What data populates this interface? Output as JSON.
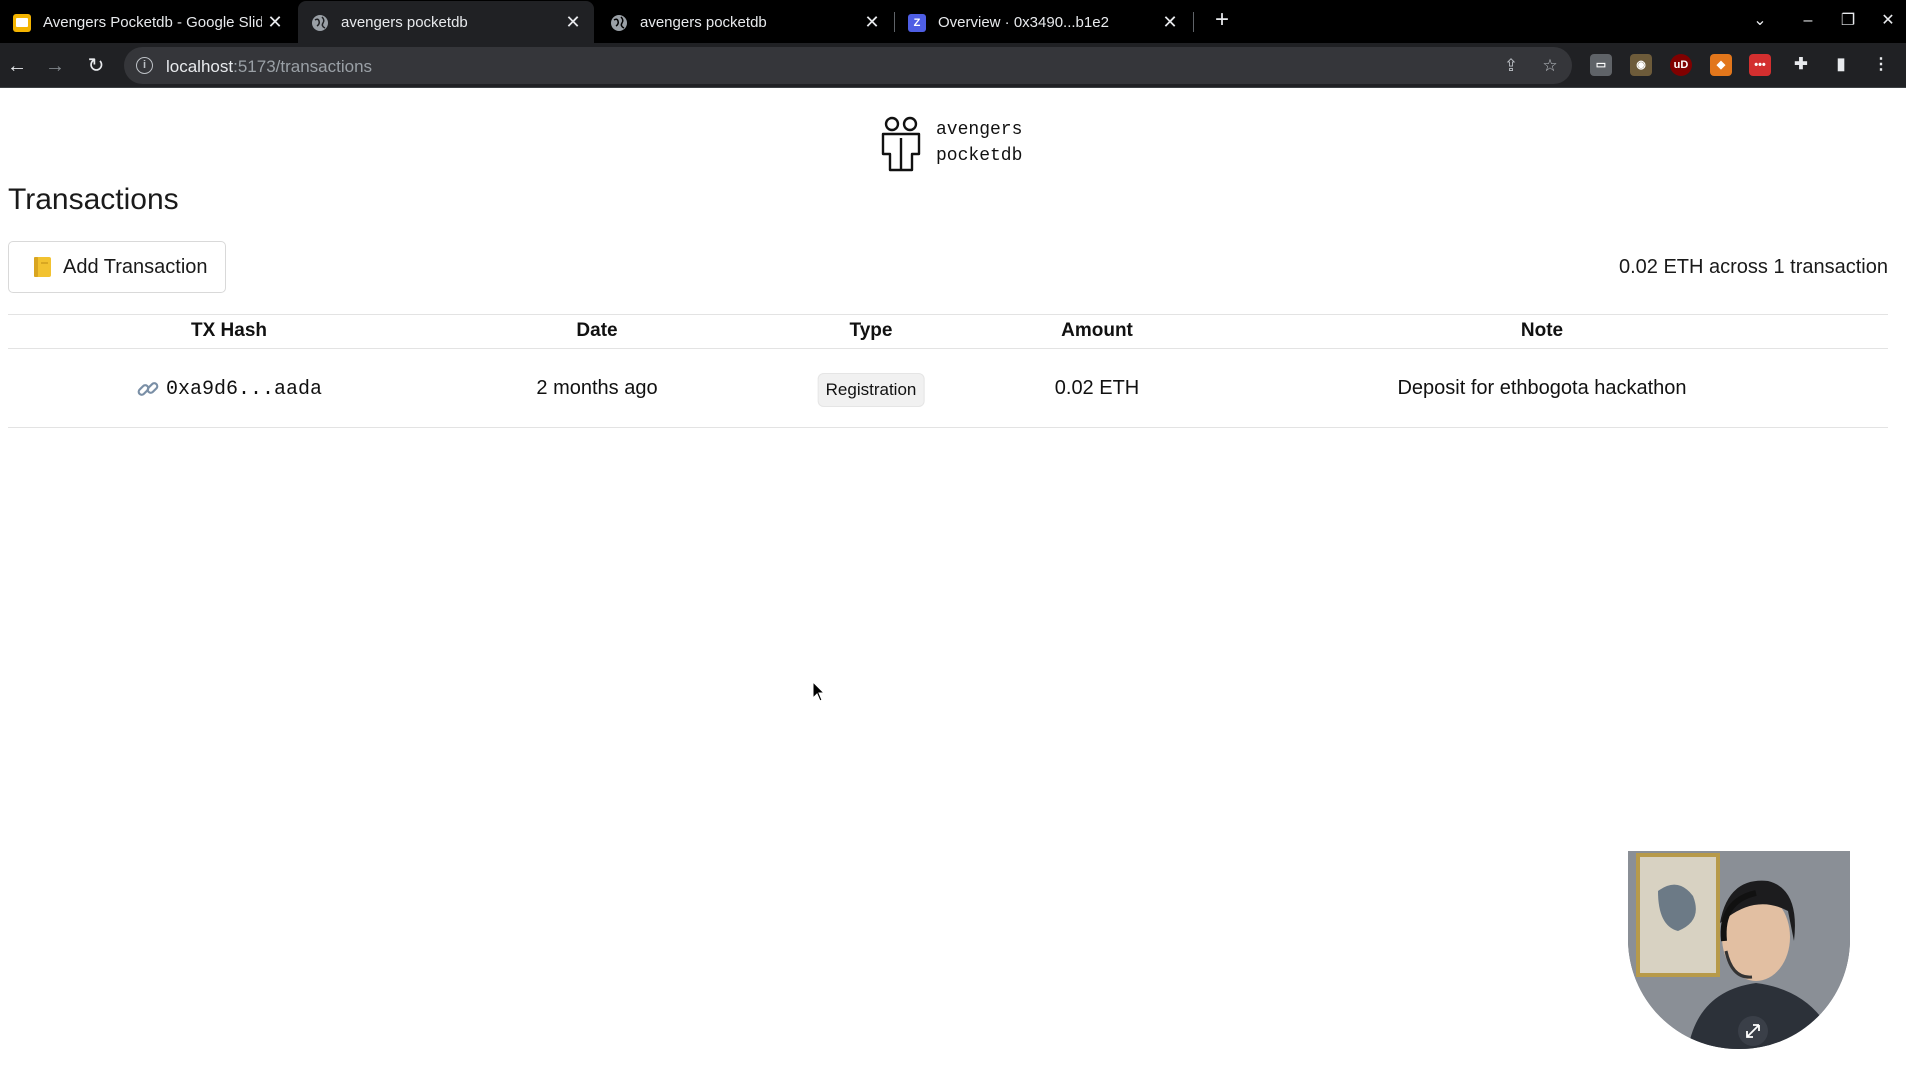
{
  "browser": {
    "tabs": [
      {
        "title": "Avengers Pocketdb - Google Slid",
        "favicon": "google-slides-icon",
        "active": false
      },
      {
        "title": "avengers pocketdb",
        "favicon": "globe-icon",
        "active": true
      },
      {
        "title": "avengers pocketdb",
        "favicon": "globe-icon",
        "active": false
      },
      {
        "title": "Overview · 0x3490...b1e2",
        "favicon": "zksync-icon",
        "active": false
      }
    ],
    "url_host": "localhost",
    "url_path": ":5173/transactions"
  },
  "brand": {
    "line1": "avengers",
    "line2": "pocketdb"
  },
  "page": {
    "title": "Transactions",
    "add_button_label": "Add Transaction",
    "summary": "0.02 ETH across 1 transaction"
  },
  "table": {
    "headers": [
      "TX Hash",
      "Date",
      "Type",
      "Amount",
      "Note"
    ],
    "rows": [
      {
        "tx_hash": "0xa9d6...aada",
        "date": "2 months ago",
        "type": "Registration",
        "amount": "0.02 ETH",
        "note": "Deposit for ethbogota hackathon"
      }
    ]
  },
  "colors": {
    "tab_bar": "#000000",
    "toolbar": "#202124",
    "omnibox": "#35363a",
    "badge_bg": "#f1f1f1"
  }
}
